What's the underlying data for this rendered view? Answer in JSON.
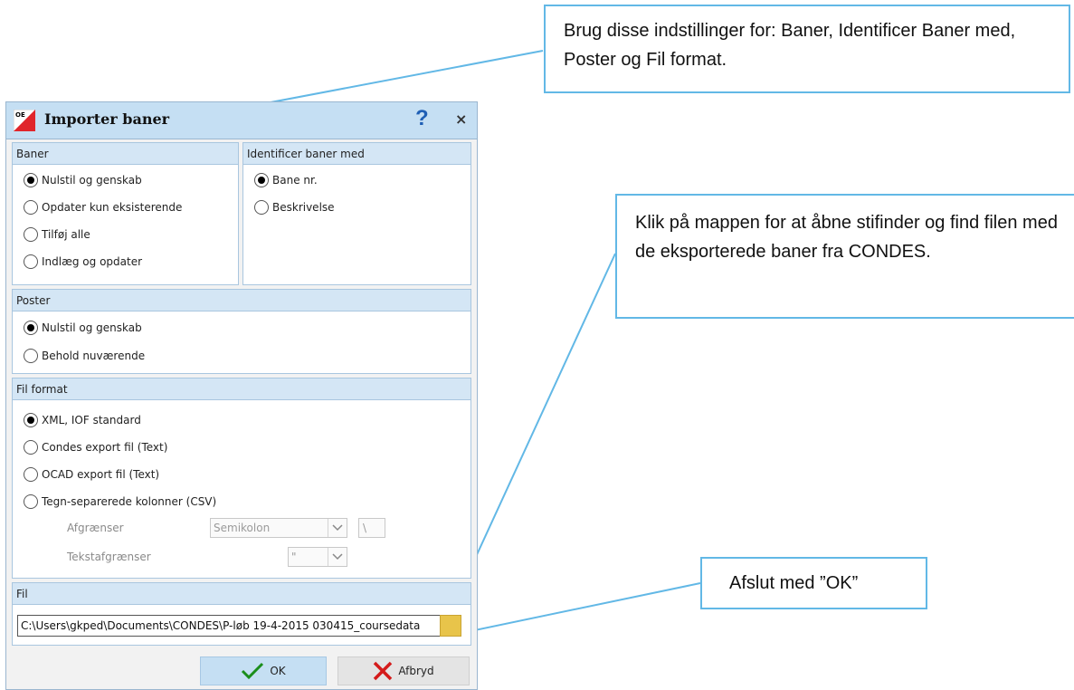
{
  "dialog": {
    "title": "Importer baner",
    "help": "?",
    "close": "×",
    "app_icon_text": "OE",
    "baner": {
      "header": "Baner",
      "options": [
        {
          "label": "Nulstil og genskab",
          "checked": true
        },
        {
          "label": "Opdater kun eksisterende",
          "checked": false
        },
        {
          "label": "Tilføj alle",
          "checked": false
        },
        {
          "label": "Indlæg og opdater",
          "checked": false
        }
      ]
    },
    "identify": {
      "header": "Identificer baner med",
      "options": [
        {
          "label": "Bane nr.",
          "checked": true
        },
        {
          "label": "Beskrivelse",
          "checked": false
        }
      ]
    },
    "poster": {
      "header": "Poster",
      "options": [
        {
          "label": "Nulstil og genskab",
          "checked": true
        },
        {
          "label": "Behold nuværende",
          "checked": false
        }
      ]
    },
    "file_format": {
      "header": "Fil format",
      "options": [
        {
          "label": "XML, IOF standard",
          "checked": true
        },
        {
          "label": "Condes export fil (Text)",
          "checked": false
        },
        {
          "label": "OCAD export fil (Text)",
          "checked": false
        },
        {
          "label": "Tegn-separerede kolonner (CSV)",
          "checked": false
        }
      ],
      "delimiter_label": "Afgrænser",
      "delimiter_value": "Semikolon",
      "delimiter_char": "\\",
      "text_delimiter_label": "Tekstafgrænser",
      "text_delimiter_value": "\""
    },
    "file": {
      "header": "Fil",
      "path": "C:\\Users\\gkped\\Documents\\CONDES\\P-løb 19-4-2015 030415_coursedata"
    },
    "buttons": {
      "ok": "OK",
      "cancel": "Afbryd"
    }
  },
  "callouts": {
    "settings": "Brug disse indstillinger for: Baner, Identificer Baner med, Poster og Fil format.",
    "folder": "Klik på mappen for at åbne stifinder og find filen med de eksporterede baner fra CONDES.",
    "ok": "Afslut med ”OK”"
  },
  "colors": {
    "titlebar": "#c5dff3",
    "panel_header": "#d4e6f5",
    "callout_border": "#62b8e6",
    "help_icon": "#1f5fb5",
    "folder": "#e8c44a",
    "check": "#1b8e1b",
    "cross": "#d41b1b"
  }
}
